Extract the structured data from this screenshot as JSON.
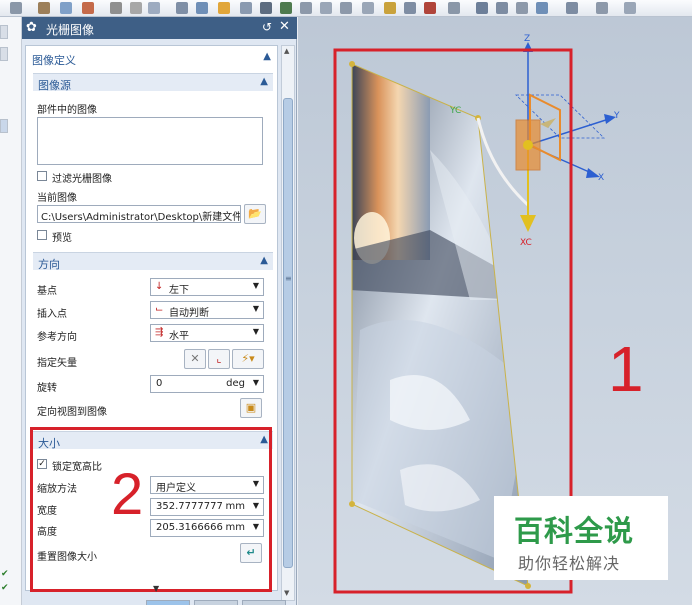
{
  "dialog": {
    "title": "光栅图像",
    "reset_icon": "reset-icon",
    "close_icon": "close-icon",
    "image_definition": {
      "header": "图像定义",
      "source": {
        "header": "图像源",
        "part_images_label": "部件中的图像",
        "filter_label": "过滤光栅图像",
        "filter_checked": false,
        "current_image_label": "当前图像",
        "current_image_path": "C:\\Users\\Administrator\\Desktop\\新建文件夹",
        "preview_label": "预览",
        "preview_checked": false
      },
      "orientation": {
        "header": "方向",
        "base_point_label": "基点",
        "base_point_value": "左下",
        "insert_point_label": "插入点",
        "insert_point_value": "自动判断",
        "ref_direction_label": "参考方向",
        "ref_direction_value": "水平",
        "specify_vector_label": "指定矢量",
        "rotation_label": "旋转",
        "rotation_value": "0",
        "rotation_unit": "deg",
        "orient_view_label": "定向视图到图像"
      },
      "size": {
        "header": "大小",
        "lock_aspect_label": "锁定宽高比",
        "lock_aspect_checked": true,
        "scale_method_label": "缩放方法",
        "scale_method_value": "用户定义",
        "width_label": "宽度",
        "width_value": "352.7777777",
        "width_unit": "mm",
        "height_label": "高度",
        "height_value": "205.3166666",
        "height_unit": "mm",
        "reset_size_label": "重置图像大小"
      }
    }
  },
  "annotations": {
    "number_1": "1",
    "number_2": "2"
  },
  "viewport": {
    "axis_x": "X",
    "axis_y": "Y",
    "axis_z": "Z",
    "handle_xc": "XC",
    "handle_yc": "YC"
  },
  "watermark": {
    "title": "百科全说",
    "subtitle": "助你轻松解决"
  },
  "colors": {
    "title_bar": "#3e5f86",
    "annotation_red": "#d7212a",
    "watermark_green": "#2e9a4a"
  }
}
